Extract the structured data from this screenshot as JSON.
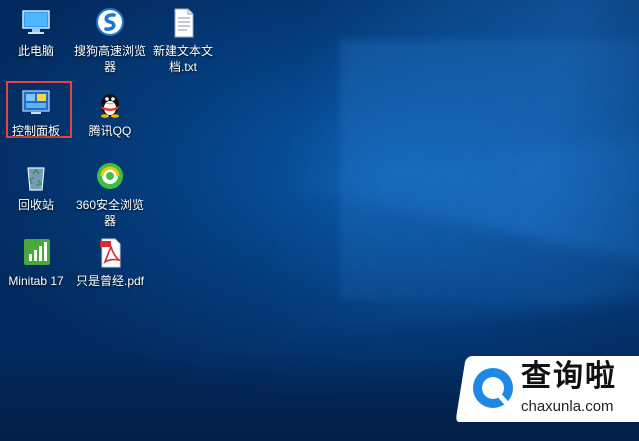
{
  "desktop_icons": [
    {
      "name": "this-pc",
      "icon": "monitor-icon",
      "label": "此电脑"
    },
    {
      "name": "sogou-browser",
      "icon": "sogou-browser-icon",
      "label": "搜狗高速浏览器"
    },
    {
      "name": "new-text-file",
      "icon": "text-file-icon",
      "label": "新建文本文档.txt"
    },
    {
      "name": "control-panel",
      "icon": "control-panel-icon",
      "label": "控制面板"
    },
    {
      "name": "tencent-qq",
      "icon": "qq-penguin-icon",
      "label": "腾讯QQ"
    },
    {
      "name": "recycle-bin",
      "icon": "recycle-bin-icon",
      "label": "回收站"
    },
    {
      "name": "360-browser",
      "icon": "360-browser-icon",
      "label": "360安全浏览器"
    },
    {
      "name": "minitab",
      "icon": "minitab-icon",
      "label": "Minitab 17"
    },
    {
      "name": "pdf-file",
      "icon": "pdf-file-icon",
      "label": "只是曾经.pdf"
    }
  ],
  "selected_icon": "控制面板",
  "watermark": {
    "title": "查询啦",
    "domain": "chaxunla.com",
    "accent": "#1e88e5"
  }
}
